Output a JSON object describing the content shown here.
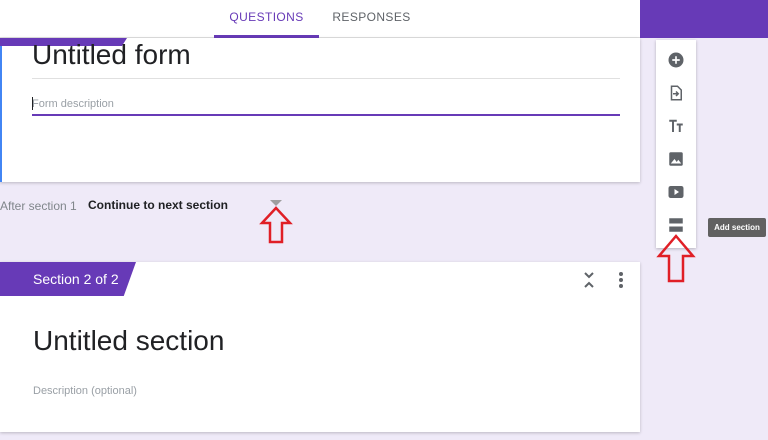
{
  "tabs": [
    {
      "label": "QUESTIONS",
      "active": true
    },
    {
      "label": "RESPONSES",
      "active": false
    }
  ],
  "accent_color": "#673ab7",
  "form": {
    "title": "Untitled form",
    "description_placeholder": "Form description"
  },
  "navigation": {
    "after_label": "After section 1",
    "after_value": "Continue to next section"
  },
  "sidebar": {
    "tools": [
      {
        "icon": "add-question-icon"
      },
      {
        "icon": "import-questions-icon"
      },
      {
        "icon": "add-title-icon"
      },
      {
        "icon": "add-image-icon"
      },
      {
        "icon": "add-video-icon"
      },
      {
        "icon": "add-section-icon"
      }
    ],
    "tooltip": "Add section"
  },
  "section2": {
    "tab_label": "Section 2 of 2",
    "title": "Untitled section",
    "description_placeholder": "Description (optional)"
  },
  "annotations": {
    "arrow_color": "#e01f26"
  }
}
